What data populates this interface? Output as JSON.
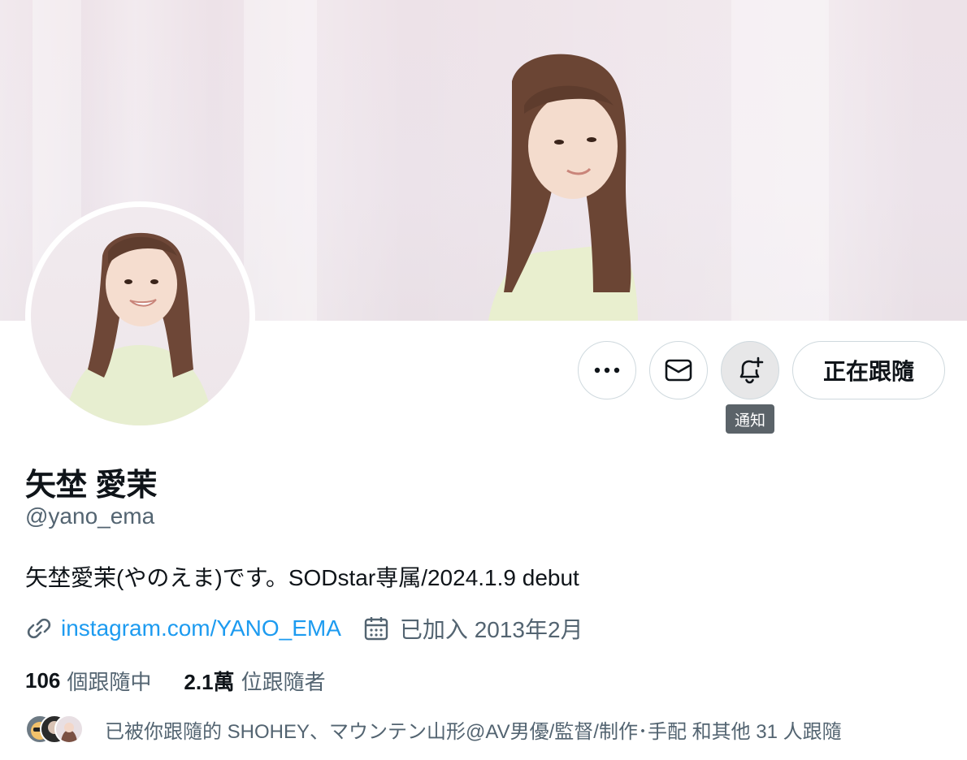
{
  "profile": {
    "name": "矢埜 愛茉",
    "handle": "@yano_ema",
    "bio": "矢埜愛茉(やのえま)です。SODstar専属/2024.1.9 debut",
    "website": "instagram.com/YANO_EMA",
    "joined": "已加入 2013年2月"
  },
  "actions": {
    "follow_label": "正在跟隨",
    "notify_tooltip": "通知",
    "more_icon": "more-horizontal-icon",
    "message_icon": "envelope-icon",
    "notify_icon": "bell-plus-icon"
  },
  "stats": {
    "following_count": "106",
    "following_label": "個跟隨中",
    "followers_count": "2.1萬",
    "followers_label": "位跟隨者"
  },
  "followed_by": {
    "text": "已被你跟隨的 SHOHEY、マウンテン山形@AV男優/監督/制作･手配 和其他 31 人跟隨"
  },
  "colors": {
    "link": "#1d9bf0",
    "secondary_text": "#536471",
    "primary_text": "#0f1419",
    "border": "#cfd9de",
    "tooltip_bg": "#5b6369"
  }
}
